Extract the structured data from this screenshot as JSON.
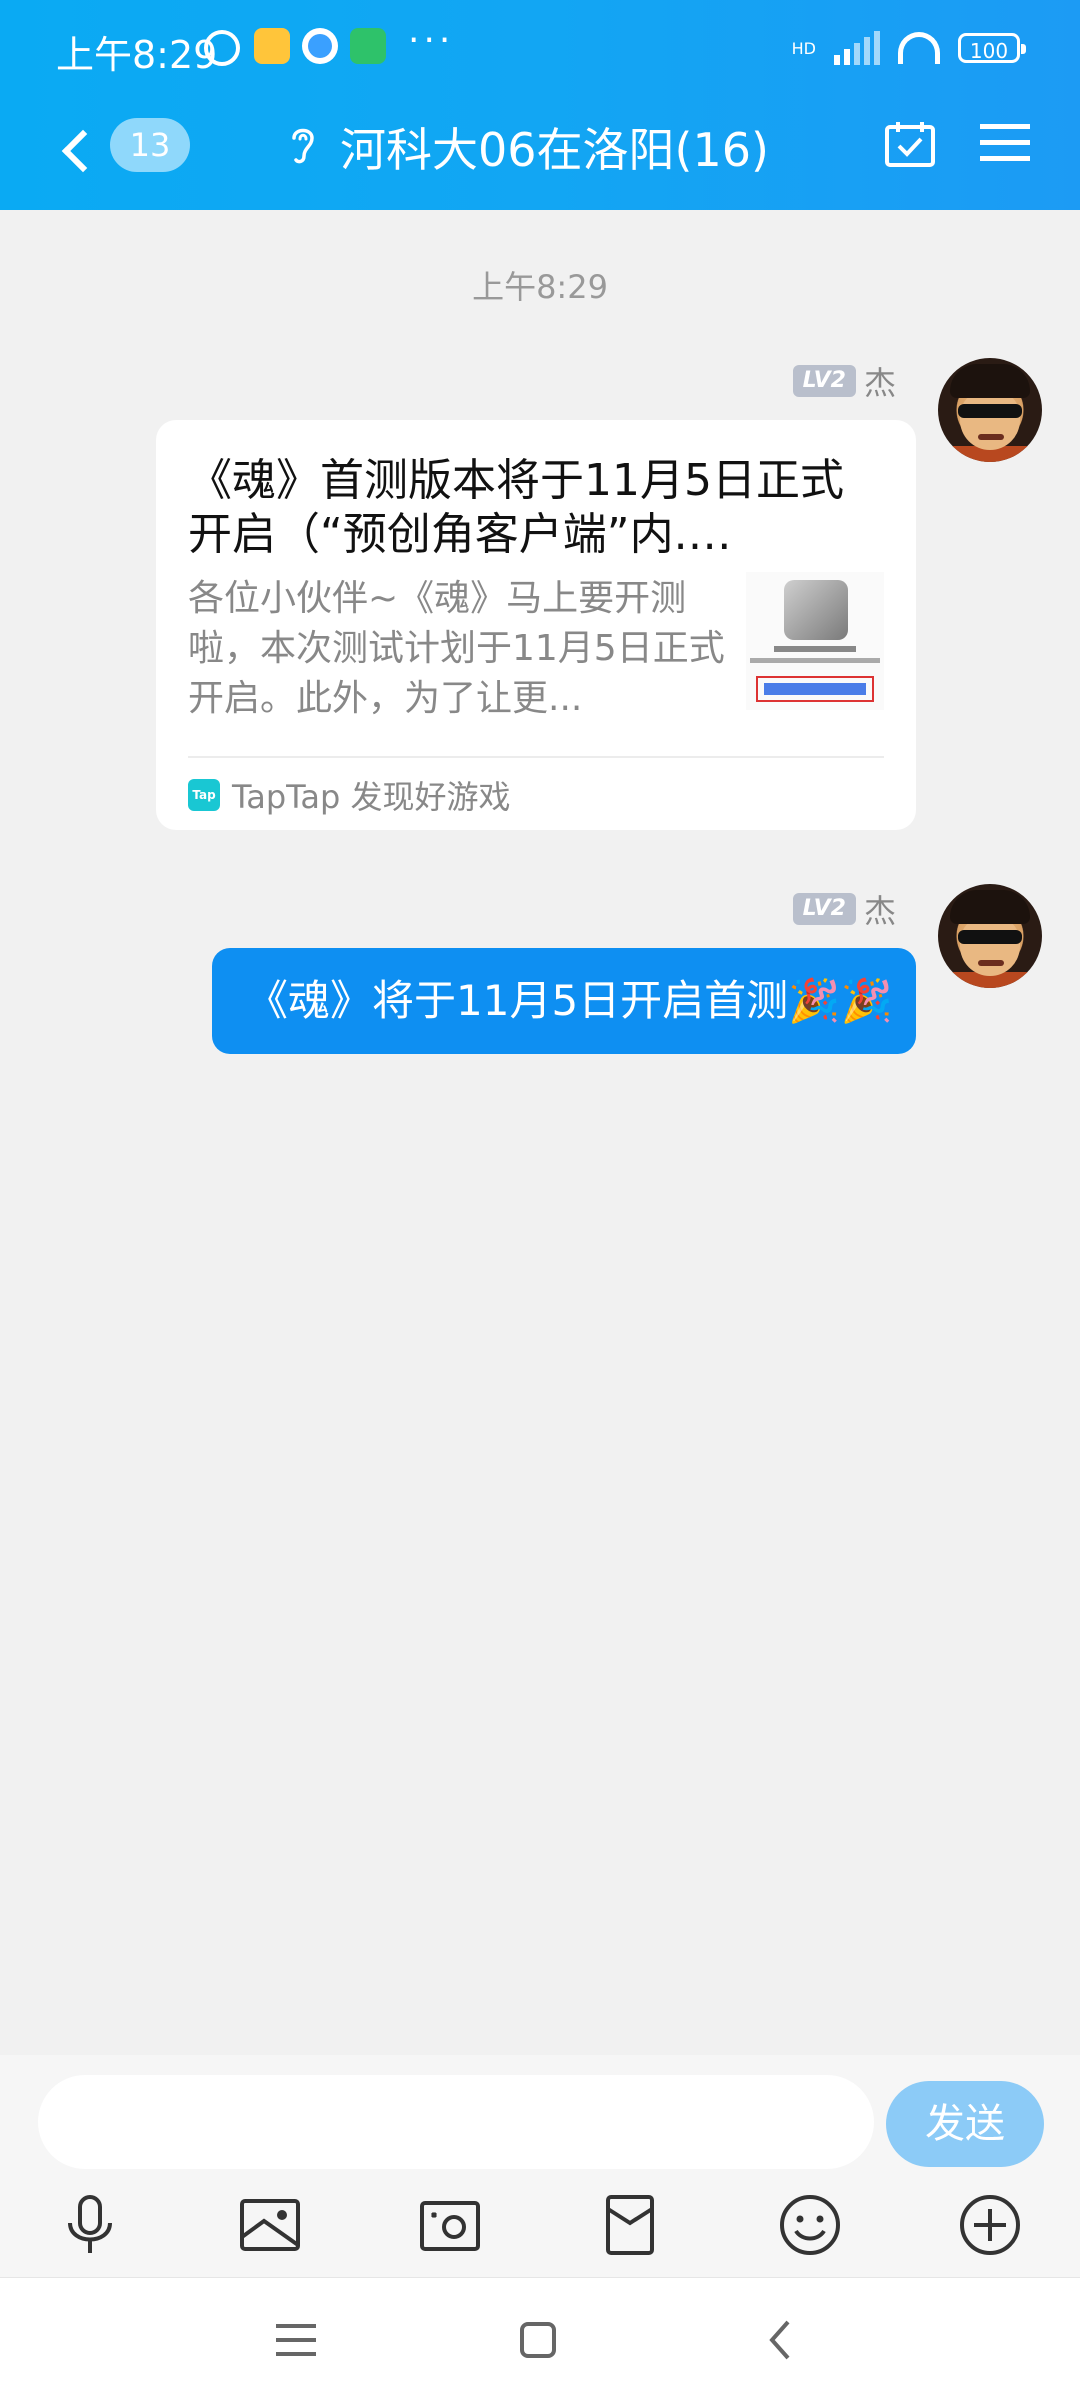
{
  "status_bar": {
    "time": "上午8:29",
    "overflow": "···",
    "battery": "100",
    "network_label": "HD"
  },
  "nav": {
    "unread_count": "13",
    "group_title": "河科大06在洛阳(16)",
    "icons": [
      "back-icon",
      "ear-icon",
      "calendar-check-icon",
      "menu-icon"
    ]
  },
  "chat": {
    "timestamp": "上午8:29",
    "messages": [
      {
        "sender_level": "LV2",
        "sender_name": "杰",
        "type": "link-card",
        "title": "《魂》首测版本将于11月5日正式开启（“预创角客户端”内.…",
        "description": "各位小伙伴~《魂》马上要开测啦，本次测试计划于11月5日正式开启。此外，为了让更...",
        "source": "TapTap 发现好游戏",
        "source_icon_text": "Tap"
      },
      {
        "sender_level": "LV2",
        "sender_name": "杰",
        "type": "text",
        "text": "《魂》将于11月5日开启首测🎉🎉"
      }
    ]
  },
  "input": {
    "placeholder": "",
    "send_label": "发送",
    "tools": [
      "microphone-icon",
      "image-icon",
      "camera-icon",
      "red-packet-icon",
      "emoji-icon",
      "plus-icon"
    ]
  },
  "colors": {
    "header": "#12a6f3",
    "bubble": "#0e8ff2",
    "send_button": "#8ccbf7",
    "background": "#f1f1f1"
  }
}
